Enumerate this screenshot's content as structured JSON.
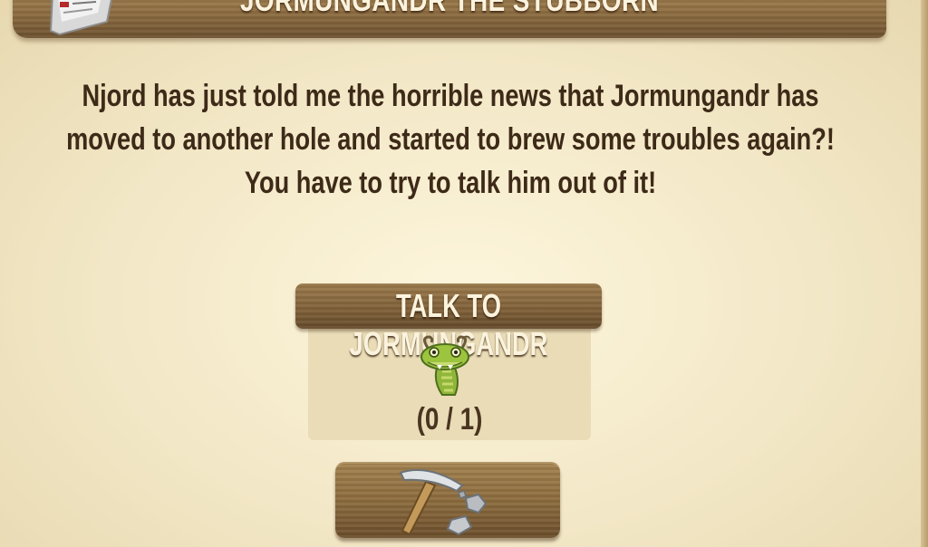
{
  "quest": {
    "title": "JORMUNGANDR THE STUBBORN",
    "description": "Njord has just told me the horrible news that Jormungandr has moved to another hole and started to brew some troubles again?! You have to try to talk him out of it!"
  },
  "task": {
    "label": "TALK TO JORMUNGANDR",
    "progress_text": "(0 / 1)",
    "progress_current": 0,
    "progress_total": 1,
    "icon": "serpent-icon"
  },
  "action": {
    "icon": "pickaxe-icon"
  },
  "colors": {
    "parchment": "#efe3bf",
    "wood": "#8a6a3f",
    "text_dark": "#3e2a18",
    "text_light": "#fbf3dd"
  }
}
